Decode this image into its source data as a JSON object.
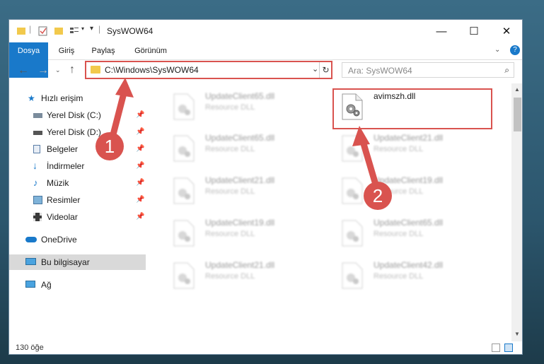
{
  "window": {
    "title": "SysWOW64"
  },
  "ribbon": {
    "tabs": [
      "Dosya",
      "Giriş",
      "Paylaş",
      "Görünüm"
    ]
  },
  "address": {
    "path": "C:\\Windows\\SysWOW64"
  },
  "search": {
    "placeholder": "Ara: SysWOW64"
  },
  "sidebar": {
    "items": [
      {
        "label": "Hızlı erişim",
        "icon": "star-icon"
      },
      {
        "label": "Yerel Disk (C:)",
        "icon": "drive-icon"
      },
      {
        "label": "Yerel Disk (D:)",
        "icon": "drive-icon"
      },
      {
        "label": "Belgeler",
        "icon": "documents-icon"
      },
      {
        "label": "İndirmeler",
        "icon": "download-icon"
      },
      {
        "label": "Müzik",
        "icon": "music-icon"
      },
      {
        "label": "Resimler",
        "icon": "pictures-icon"
      },
      {
        "label": "Videolar",
        "icon": "videos-icon"
      },
      {
        "label": "OneDrive",
        "icon": "cloud-icon"
      },
      {
        "label": "Bu bilgisayar",
        "icon": "computer-icon"
      },
      {
        "label": "Ağ",
        "icon": "network-icon"
      }
    ]
  },
  "files": [
    {
      "name": "UpdateClient65.dll",
      "type": "Resource DLL"
    },
    {
      "name": "avimszh.dll",
      "type": ""
    },
    {
      "name": "UpdateClient65.dll",
      "type": "Resource DLL"
    },
    {
      "name": "UpdateClient21.dll",
      "type": "Resource DLL"
    },
    {
      "name": "UpdateClient21.dll",
      "type": "Resource DLL"
    },
    {
      "name": "UpdateClient19.dll",
      "type": "Resource DLL"
    },
    {
      "name": "UpdateClient19.dll",
      "type": "Resource DLL"
    },
    {
      "name": "UpdateClient65.dll",
      "type": "Resource DLL"
    },
    {
      "name": "UpdateClient21.dll",
      "type": "Resource DLL"
    },
    {
      "name": "UpdateClient42.dll",
      "type": "Resource DLL"
    }
  ],
  "status": {
    "count": "130 öğe"
  },
  "markers": [
    "1",
    "2"
  ],
  "colors": {
    "accent": "#1979ca",
    "highlight": "#d9534f",
    "folder": "#f2c94c"
  }
}
